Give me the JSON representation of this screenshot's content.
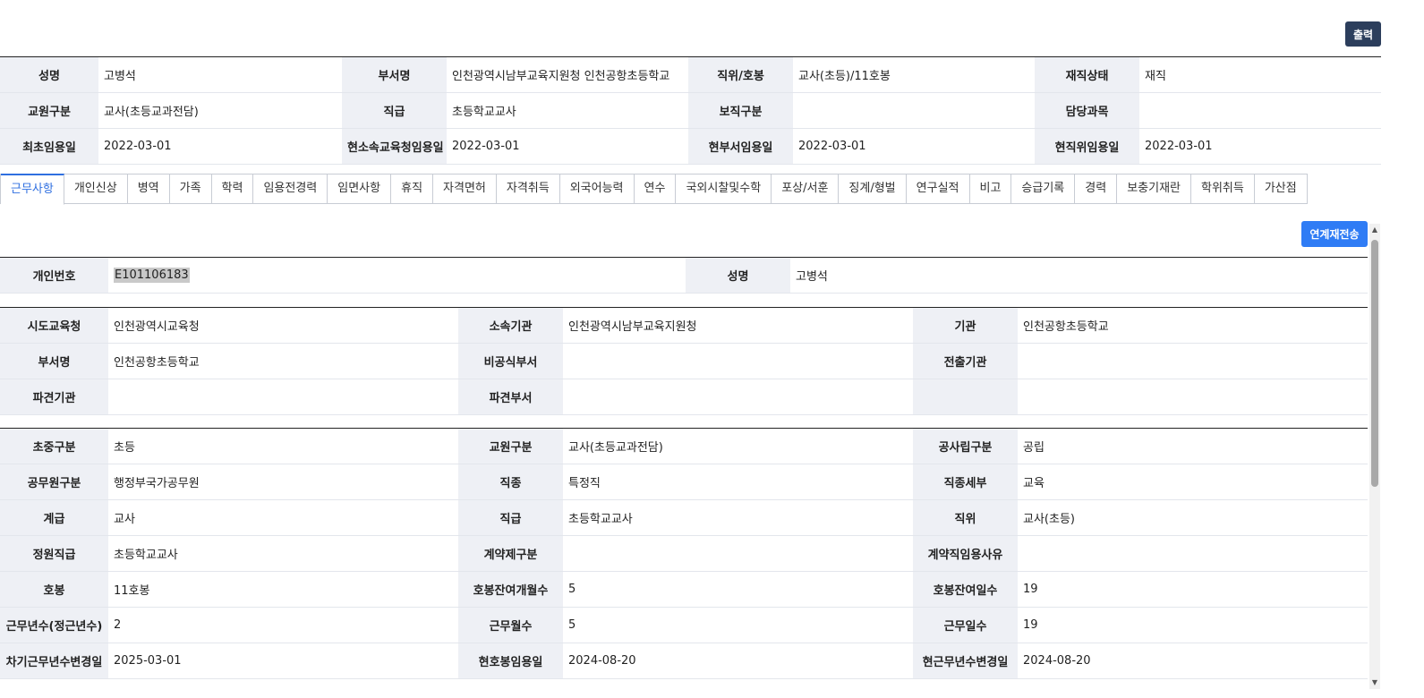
{
  "toolbar": {
    "print_label": "출력",
    "resend_label": "연계재전송"
  },
  "summary": {
    "rows": [
      [
        {
          "label": "성명",
          "value": "고병석"
        },
        {
          "label": "부서명",
          "value": "인천광역시남부교육지원청 인천공항초등학교"
        },
        {
          "label": "직위/호봉",
          "value": "교사(초등)/11호봉"
        },
        {
          "label": "재직상태",
          "value": "재직"
        }
      ],
      [
        {
          "label": "교원구분",
          "value": "교사(초등교과전담)"
        },
        {
          "label": "직급",
          "value": "초등학교교사"
        },
        {
          "label": "보직구분",
          "value": ""
        },
        {
          "label": "담당과목",
          "value": ""
        }
      ],
      [
        {
          "label": "최초임용일",
          "value": "2022-03-01"
        },
        {
          "label": "현소속교육청임용일",
          "value": "2022-03-01"
        },
        {
          "label": "현부서임용일",
          "value": "2022-03-01"
        },
        {
          "label": "현직위임용일",
          "value": "2022-03-01"
        }
      ]
    ]
  },
  "tabs": [
    "근무사항",
    "개인신상",
    "병역",
    "가족",
    "학력",
    "임용전경력",
    "임면사항",
    "휴직",
    "자격면허",
    "자격취득",
    "외국어능력",
    "연수",
    "국외시찰및수학",
    "포상/서훈",
    "징계/형벌",
    "연구실적",
    "비고",
    "승급기록",
    "경력",
    "보충기재란",
    "학위취득",
    "가산점"
  ],
  "active_tab": 0,
  "personal": {
    "id_label": "개인번호",
    "id_value": "E101106183",
    "name_label": "성명",
    "name_value": "고병석"
  },
  "org": {
    "rows": [
      [
        {
          "label": "시도교육청",
          "value": "인천광역시교육청"
        },
        {
          "label": "소속기관",
          "value": "인천광역시남부교육지원청"
        },
        {
          "label": "기관",
          "value": "인천공항초등학교"
        }
      ],
      [
        {
          "label": "부서명",
          "value": "인천공항초등학교"
        },
        {
          "label": "비공식부서",
          "value": ""
        },
        {
          "label": "전출기관",
          "value": ""
        }
      ],
      [
        {
          "label": "파견기관",
          "value": ""
        },
        {
          "label": "파견부서",
          "value": ""
        },
        {
          "label": "",
          "value": ""
        }
      ]
    ]
  },
  "detail": {
    "rows": [
      [
        {
          "label": "초중구분",
          "value": "초등"
        },
        {
          "label": "교원구분",
          "value": "교사(초등교과전담)"
        },
        {
          "label": "공사립구분",
          "value": "공립"
        }
      ],
      [
        {
          "label": "공무원구분",
          "value": "행정부국가공무원"
        },
        {
          "label": "직종",
          "value": "특정직"
        },
        {
          "label": "직종세부",
          "value": "교육"
        }
      ],
      [
        {
          "label": "계급",
          "value": "교사"
        },
        {
          "label": "직급",
          "value": "초등학교교사"
        },
        {
          "label": "직위",
          "value": "교사(초등)"
        }
      ],
      [
        {
          "label": "정원직급",
          "value": "초등학교교사"
        },
        {
          "label": "계약제구분",
          "value": ""
        },
        {
          "label": "계약직임용사유",
          "value": ""
        }
      ],
      [
        {
          "label": "호봉",
          "value": "11호봉"
        },
        {
          "label": "호봉잔여개월수",
          "value": "5"
        },
        {
          "label": "호봉잔여일수",
          "value": "19"
        }
      ],
      [
        {
          "label": "근무년수(정근년수)",
          "value": "2"
        },
        {
          "label": "근무월수",
          "value": "5"
        },
        {
          "label": "근무일수",
          "value": "19"
        }
      ],
      [
        {
          "label": "차기근무년수변경일",
          "value": "2025-03-01"
        },
        {
          "label": "현호봉임용일",
          "value": "2024-08-20"
        },
        {
          "label": "현근무년수변경일",
          "value": "2024-08-20"
        }
      ]
    ]
  },
  "colors": {
    "accent": "#2f6fe0",
    "print_button": "#2c3e5c",
    "resend_button": "#2f7cf5",
    "label_bg": "#eef0f5"
  }
}
